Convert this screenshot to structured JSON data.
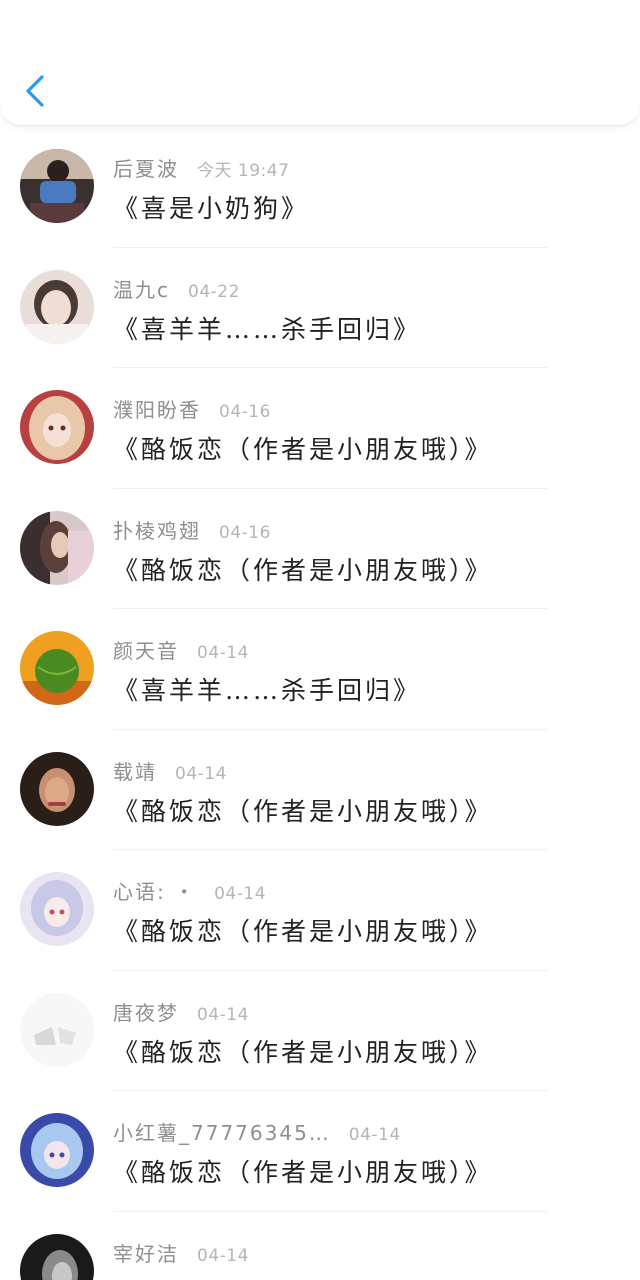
{
  "nav": {
    "back_icon": "chevron-left-icon",
    "accent": "#2a9ae8"
  },
  "items": [
    {
      "name": "后夏波",
      "time": "今天 19:47",
      "title": "《喜是小奶狗》",
      "avatar_colors": [
        "#3a3030",
        "#4a7ac0"
      ]
    },
    {
      "name": "温九c",
      "time": "04-22",
      "title": "《喜羊羊……杀手回归》",
      "avatar_colors": [
        "#d8c8c0",
        "#f3ece8"
      ]
    },
    {
      "name": "濮阳盼香",
      "time": "04-16",
      "title": "《酪饭恋（作者是小朋友哦）》",
      "avatar_colors": [
        "#c84a4a",
        "#e8c8a8"
      ]
    },
    {
      "name": "扑棱鸡翅",
      "time": "04-16",
      "title": "《酪饭恋（作者是小朋友哦）》",
      "avatar_colors": [
        "#4a3a3a",
        "#d8b8b0"
      ]
    },
    {
      "name": "颜天音",
      "time": "04-14",
      "title": "《喜羊羊……杀手回归》",
      "avatar_colors": [
        "#f0a020",
        "#4a8a20"
      ]
    },
    {
      "name": "载靖",
      "time": "04-14",
      "title": "《酪饭恋（作者是小朋友哦）》",
      "avatar_colors": [
        "#2a1e18",
        "#c89070"
      ]
    },
    {
      "name": "心语: ・",
      "time": "04-14",
      "title": "《酪饭恋（作者是小朋友哦）》",
      "avatar_colors": [
        "#c8c8e8",
        "#f0e8f0"
      ]
    },
    {
      "name": "唐夜梦",
      "time": "04-14",
      "title": "《酪饭恋（作者是小朋友哦）》",
      "avatar_colors": [
        "#d8d8d8",
        "#f4f4f4"
      ]
    },
    {
      "name": "小红薯_77776345…",
      "time": "04-14",
      "title": "《酪饭恋（作者是小朋友哦）》",
      "avatar_colors": [
        "#3a4aa8",
        "#a8c8f0"
      ]
    },
    {
      "name": "宰好洁",
      "time": "04-14",
      "title": "",
      "avatar_colors": [
        "#1a1a1a",
        "#8a8a8a"
      ]
    }
  ]
}
